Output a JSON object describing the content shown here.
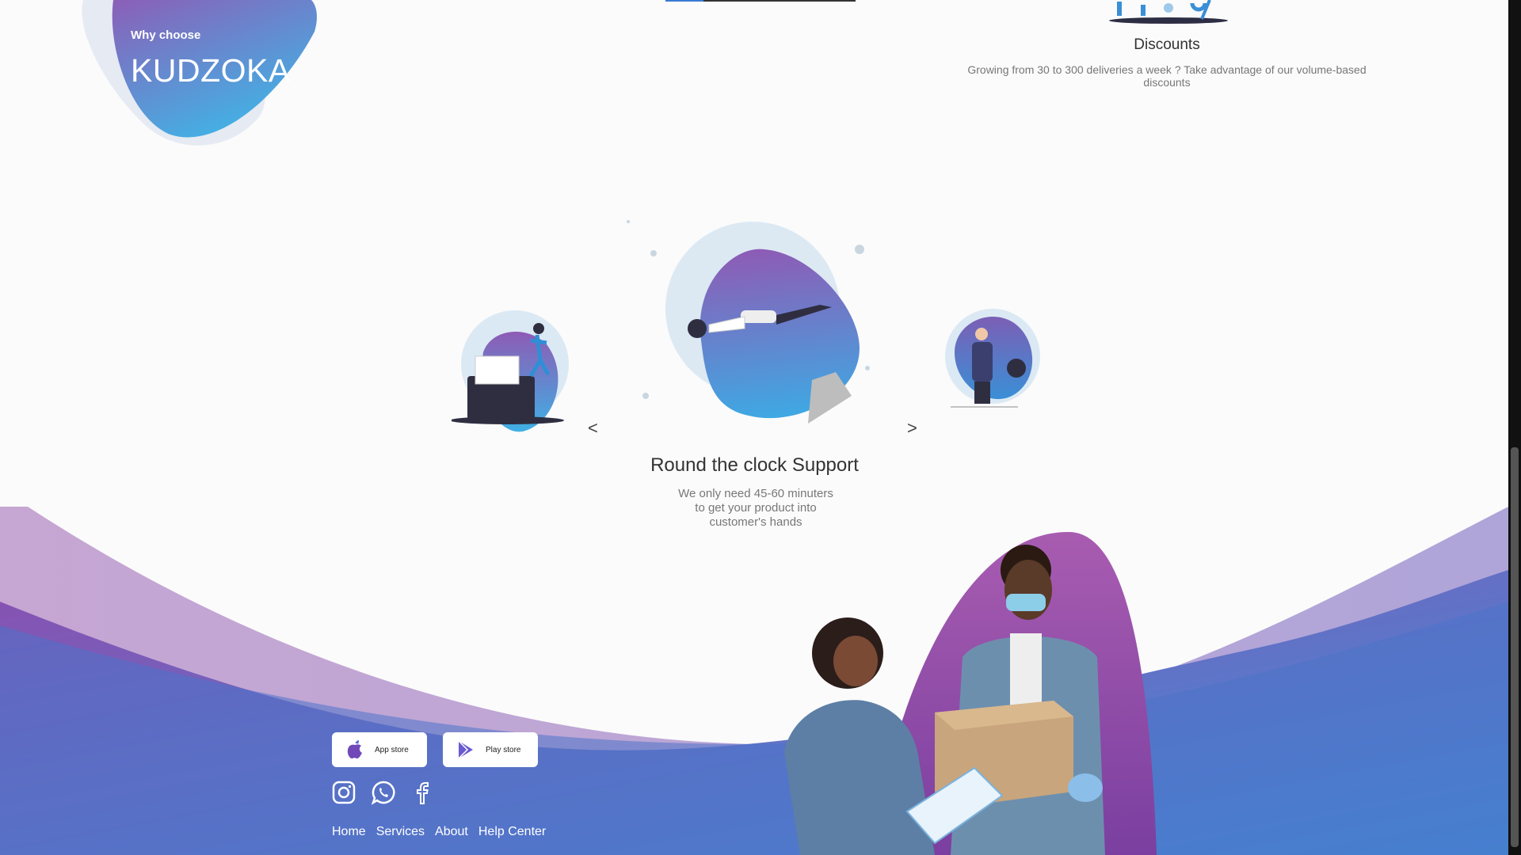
{
  "hero": {
    "small": "Why choose",
    "big": "KUDZOKA"
  },
  "feature_discounts": {
    "title": "Discounts",
    "text": "Growing from 30 to 300 deliveries a week ? Take advantage of our volume-based discounts"
  },
  "carousel": {
    "prev": "<",
    "next": ">",
    "title": "Round the clock Support",
    "text": "We only need 45-60 minuters to get your product into customer's hands"
  },
  "store_buttons": {
    "app_store": "App store",
    "play_store": "Play store"
  },
  "footer_nav": [
    "Home",
    "Services",
    "About",
    "Help Center"
  ],
  "colors": {
    "purple": "#8e44ad",
    "blue": "#3a8fd6",
    "light_purple": "#b27ac8"
  }
}
